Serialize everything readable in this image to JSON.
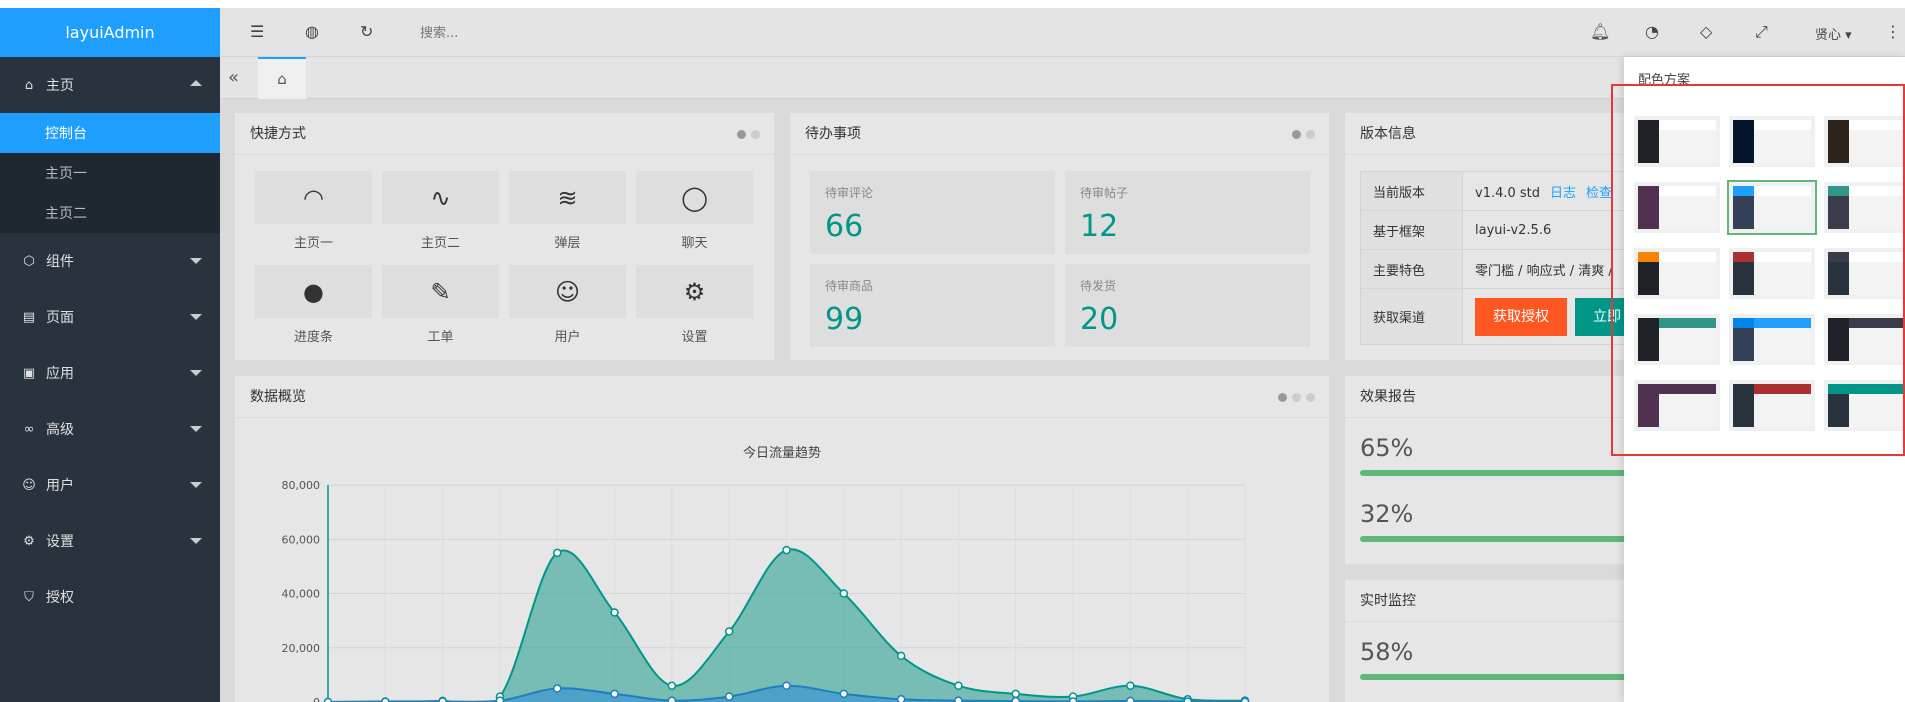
{
  "app": {
    "title": "layuiAdmin"
  },
  "header": {
    "search_placeholder": "搜索...",
    "user_name": "贤心",
    "icons": [
      "shrink-icon",
      "globe-icon",
      "refresh-icon",
      "bell-icon",
      "palette-icon",
      "tag-icon",
      "fullscreen-icon",
      "more-icon"
    ]
  },
  "sidebar": {
    "items": [
      {
        "label": "主页",
        "icon": "home-icon",
        "expanded": true,
        "children": [
          {
            "label": "控制台",
            "active": true
          },
          {
            "label": "主页一"
          },
          {
            "label": "主页二"
          }
        ]
      },
      {
        "label": "组件",
        "icon": "component-icon"
      },
      {
        "label": "页面",
        "icon": "page-icon"
      },
      {
        "label": "应用",
        "icon": "app-icon"
      },
      {
        "label": "高级",
        "icon": "senior-icon"
      },
      {
        "label": "用户",
        "icon": "user-icon"
      },
      {
        "label": "设置",
        "icon": "gear-icon"
      },
      {
        "label": "授权",
        "icon": "auth-icon"
      }
    ]
  },
  "quick": {
    "title": "快捷方式",
    "items": [
      {
        "label": "主页一",
        "icon": "gauge-icon"
      },
      {
        "label": "主页二",
        "icon": "pulse-icon"
      },
      {
        "label": "弹层",
        "icon": "layers-icon"
      },
      {
        "label": "聊天",
        "icon": "chat-icon"
      },
      {
        "label": "进度条",
        "icon": "compass-icon"
      },
      {
        "label": "工单",
        "icon": "form-edit-icon"
      },
      {
        "label": "用户",
        "icon": "user-icon"
      },
      {
        "label": "设置",
        "icon": "gear-icon"
      }
    ]
  },
  "todo": {
    "title": "待办事项",
    "items": [
      {
        "label": "待审评论",
        "value": "66"
      },
      {
        "label": "待审帖子",
        "value": "12"
      },
      {
        "label": "待审商品",
        "value": "99"
      },
      {
        "label": "待发货",
        "value": "20"
      }
    ]
  },
  "version": {
    "title": "版本信息",
    "rows": [
      {
        "key": "当前版本",
        "value": "v1.4.0 std",
        "link1": "日志",
        "link2": "检查"
      },
      {
        "key": "基于框架",
        "value": "layui-v2.5.6"
      },
      {
        "key": "主要特色",
        "value": "零门槛 / 响应式 / 清爽 /"
      },
      {
        "key": "获取渠道",
        "btn1": "获取授权",
        "btn2": "立即"
      }
    ]
  },
  "overview": {
    "title": "数据概览"
  },
  "chart_data": {
    "type": "area",
    "title": "今日流量趋势",
    "xlabel": "",
    "ylabel": "",
    "ylim": [
      0,
      80000
    ],
    "yticks": [
      "0",
      "20,000",
      "40,000",
      "60,000",
      "80,000"
    ],
    "x": [
      0,
      1,
      2,
      3,
      4,
      5,
      6,
      7,
      8,
      9,
      10,
      11,
      12,
      13,
      14,
      15,
      16
    ],
    "series": [
      {
        "color": "#2ec7c9",
        "values": [
          0,
          200,
          400,
          2000,
          55000,
          33000,
          6000,
          26000,
          56000,
          40000,
          17000,
          6000,
          3000,
          2000,
          6000,
          1000,
          500
        ]
      },
      {
        "color": "#5ab1ef",
        "values": [
          0,
          100,
          200,
          500,
          5000,
          3000,
          500,
          2000,
          6000,
          3000,
          1000,
          500,
          300,
          200,
          400,
          200,
          100
        ]
      }
    ],
    "grid": true
  },
  "effect": {
    "title": "效果报告",
    "items": [
      {
        "value": "65%",
        "percent": 65
      },
      {
        "value": "32%",
        "percent": 32
      }
    ]
  },
  "monitor": {
    "title": "实时监控",
    "items": [
      {
        "value": "58%",
        "percent": 58
      }
    ]
  },
  "theme_panel": {
    "title": "配色方案",
    "selected": 4,
    "swatches": [
      {
        "side": "#20222a",
        "logo": "#20222a",
        "head": "#ffffff"
      },
      {
        "side": "#03152a",
        "logo": "#03152a",
        "head": "#ffffff"
      },
      {
        "side": "#2e241b",
        "logo": "#2e241b",
        "head": "#ffffff"
      },
      {
        "side": "#50314f",
        "logo": "#50314f",
        "head": "#ffffff"
      },
      {
        "side": "#344058",
        "logo": "#1e9fff",
        "head": "#ffffff"
      },
      {
        "side": "#3a3d49",
        "logo": "#2f9688",
        "head": "#ffffff"
      },
      {
        "side": "#20222a",
        "logo": "#f78400",
        "head": "#ffffff"
      },
      {
        "side": "#28333e",
        "logo": "#aa3130",
        "head": "#ffffff"
      },
      {
        "side": "#28333e",
        "logo": "#3a3d49",
        "head": "#ffffff"
      },
      {
        "side": "#20222a",
        "logo": "#20222a",
        "head": "#2f9688"
      },
      {
        "side": "#344058",
        "logo": "#0085e8",
        "head": "#1e9fff"
      },
      {
        "side": "#20222a",
        "logo": "#20222a",
        "head": "#3a3d49"
      },
      {
        "side": "#50314f",
        "logo": "#50314f",
        "head": "#50314f"
      },
      {
        "side": "#28333e",
        "logo": "#28333e",
        "head": "#aa3130"
      },
      {
        "side": "#28333e",
        "logo": "#009688",
        "head": "#009688"
      }
    ]
  }
}
